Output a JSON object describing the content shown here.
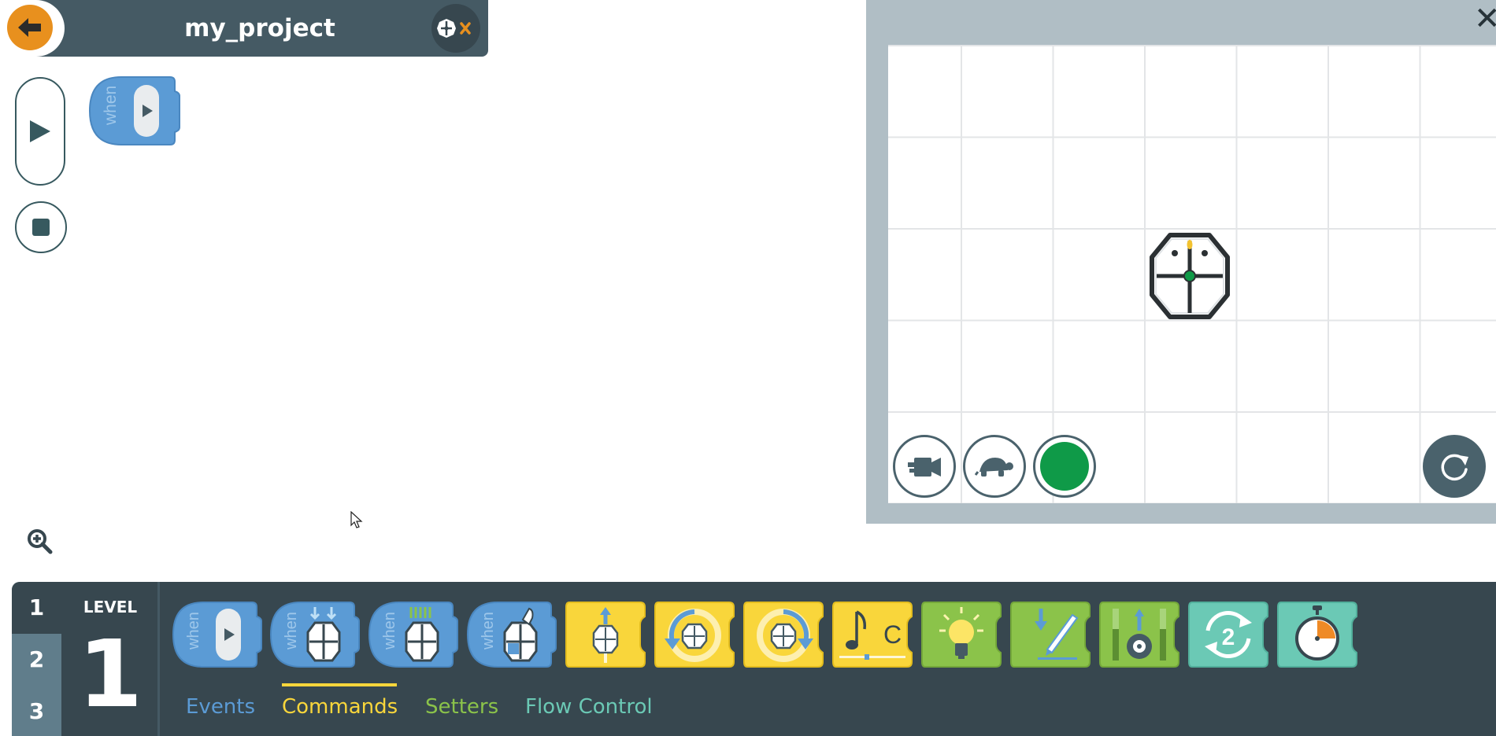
{
  "header": {
    "project_name": "my_project",
    "back_icon": "arrow-left-icon",
    "robot_connect_icon": "robot-disconnected-icon"
  },
  "workspace": {
    "play_icon": "play-icon",
    "stop_icon": "stop-icon",
    "zoom_icon": "zoom-in-icon",
    "placed_block": {
      "label": "when",
      "icon": "green-flag-play-icon"
    }
  },
  "simulator": {
    "close_icon": "close-icon",
    "buttons": [
      {
        "name": "camera",
        "icon": "video-camera-icon"
      },
      {
        "name": "speed",
        "icon": "turtle-icon"
      },
      {
        "name": "pen-color",
        "icon": "green-dot-icon",
        "color": "#0f9a48"
      }
    ],
    "reset_icon": "reset-icon"
  },
  "palette": {
    "level_tabs": [
      "1",
      "2",
      "3"
    ],
    "active_level_tab": "1",
    "level_label": "LEVEL",
    "level_number": "1",
    "blocks": [
      {
        "category": "Events",
        "label": "when",
        "icon": "play-icon"
      },
      {
        "category": "Events",
        "label": "when",
        "icon": "robot-button-press-icon"
      },
      {
        "category": "Events",
        "label": "when",
        "icon": "robot-sensors-icon"
      },
      {
        "category": "Events",
        "label": "when",
        "icon": "robot-touch-icon"
      },
      {
        "category": "Commands",
        "icon": "move-forward-icon"
      },
      {
        "category": "Commands",
        "icon": "turn-left-icon"
      },
      {
        "category": "Commands",
        "icon": "turn-right-icon"
      },
      {
        "category": "Commands",
        "icon": "play-note-icon",
        "note": "C"
      },
      {
        "category": "Setters",
        "icon": "light-bulb-icon"
      },
      {
        "category": "Setters",
        "icon": "pen-icon"
      },
      {
        "category": "Setters",
        "icon": "wheel-speed-icon"
      },
      {
        "category": "Flow Control",
        "icon": "repeat-icon",
        "count": "2"
      },
      {
        "category": "Flow Control",
        "icon": "timer-icon"
      }
    ],
    "categories": [
      {
        "label": "Events",
        "color": "#5b9bd5"
      },
      {
        "label": "Commands",
        "color": "#f9d63b"
      },
      {
        "label": "Setters",
        "color": "#8bc34a"
      },
      {
        "label": "Flow Control",
        "color": "#6bc9b5"
      }
    ],
    "active_category": "Commands"
  },
  "colors": {
    "header_bg": "#455a64",
    "back_button": "#e8901e",
    "palette_bg": "#37474f",
    "level_tabs_bg": "#607d8b",
    "sim_frame": "#b0bec5",
    "events_block": "#5b9bd5",
    "commands_block": "#f9d63b",
    "setters_block": "#8bc34a",
    "flow_block": "#6bc9b5"
  }
}
